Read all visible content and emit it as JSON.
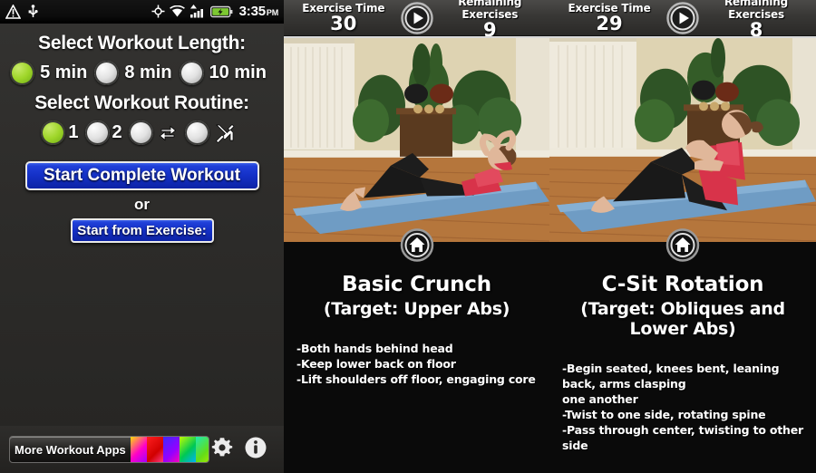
{
  "statusbar": {
    "icons_left": [
      "alert-triangle-icon",
      "usb-icon"
    ],
    "icons_right": [
      "gps-icon",
      "wifi-icon",
      "signal-icon",
      "battery-icon"
    ],
    "time": "3:35",
    "ampm": "PM"
  },
  "app": {
    "length_header": "Select Workout Length:",
    "length_options": [
      {
        "label": "5 min",
        "selected": true
      },
      {
        "label": "8 min",
        "selected": false
      },
      {
        "label": "10 min",
        "selected": false
      }
    ],
    "routine_header": "Select Workout Routine:",
    "routine_options": [
      {
        "label": "1",
        "icon": null,
        "selected": true
      },
      {
        "label": "2",
        "icon": null,
        "selected": false
      },
      {
        "label": "",
        "icon": "shuffle-repeat-icon",
        "selected": false
      },
      {
        "label": "",
        "icon": "tools-icon",
        "selected": false
      }
    ],
    "start_complete_label": "Start Complete Workout",
    "or_label": "or",
    "start_from_exercise_label": "Start from Exercise:",
    "more_apps_label": "More Workout Apps",
    "settings_icon": "gear-icon",
    "info_icon": "info-icon",
    "accent_blue": "#1430c6",
    "accent_green": "#9fd62a"
  },
  "panels": [
    {
      "time_label": "Exercise Time",
      "time_value": "30",
      "remaining_label": "Remaining Exercises",
      "remaining_value": "9",
      "play_icon": "play-icon",
      "home_icon": "home-icon",
      "title": "Basic Crunch",
      "target": "(Target: Upper Abs)",
      "notes": [
        "-Both hands behind head",
        "-Keep lower back on floor",
        "-Lift shoulders off floor, engaging core"
      ]
    },
    {
      "time_label": "Exercise Time",
      "time_value": "29",
      "remaining_label": "Remaining Exercises",
      "remaining_value": "8",
      "play_icon": "play-icon",
      "home_icon": "home-icon",
      "title": "C-Sit Rotation",
      "target": "(Target: Obliques and Lower Abs)",
      "notes": [
        "-Begin seated, knees bent, leaning back, arms clasping",
        "one another",
        "-Twist to one side, rotating spine",
        "-Pass through center, twisting to other side"
      ]
    }
  ]
}
